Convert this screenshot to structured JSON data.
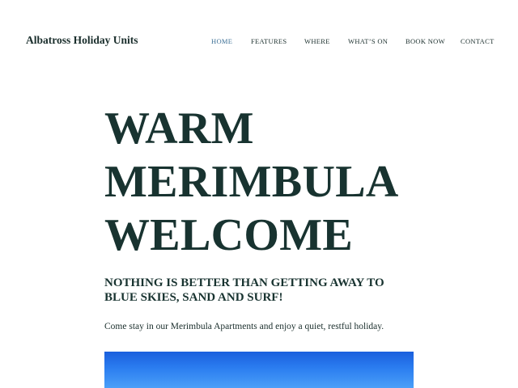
{
  "header": {
    "site_title": "Albatross Holiday Units"
  },
  "nav": {
    "items": [
      {
        "label": "HOME",
        "active": true
      },
      {
        "label": "FEATURES",
        "active": false
      },
      {
        "label": "WHERE",
        "active": false
      },
      {
        "label": "WHAT’S ON",
        "active": false
      },
      {
        "label": "BOOK NOW",
        "active": false
      },
      {
        "label": "CONTACT",
        "active": false
      }
    ],
    "active_color": "#3b6f95"
  },
  "hero": {
    "heading_lines": [
      "WARM",
      "MERIMBULA",
      "WELCOME"
    ],
    "subheading_lines": [
      "NOTHING IS BETTER THAN GETTING AWAY TO",
      "BLUE SKIES, SAND AND SURF!"
    ],
    "intro": "Come stay in our Merimbula Apartments and enjoy a quiet, restful holiday."
  },
  "colors": {
    "text_dark": "#183330",
    "sky_blue": "#2b7df0"
  }
}
